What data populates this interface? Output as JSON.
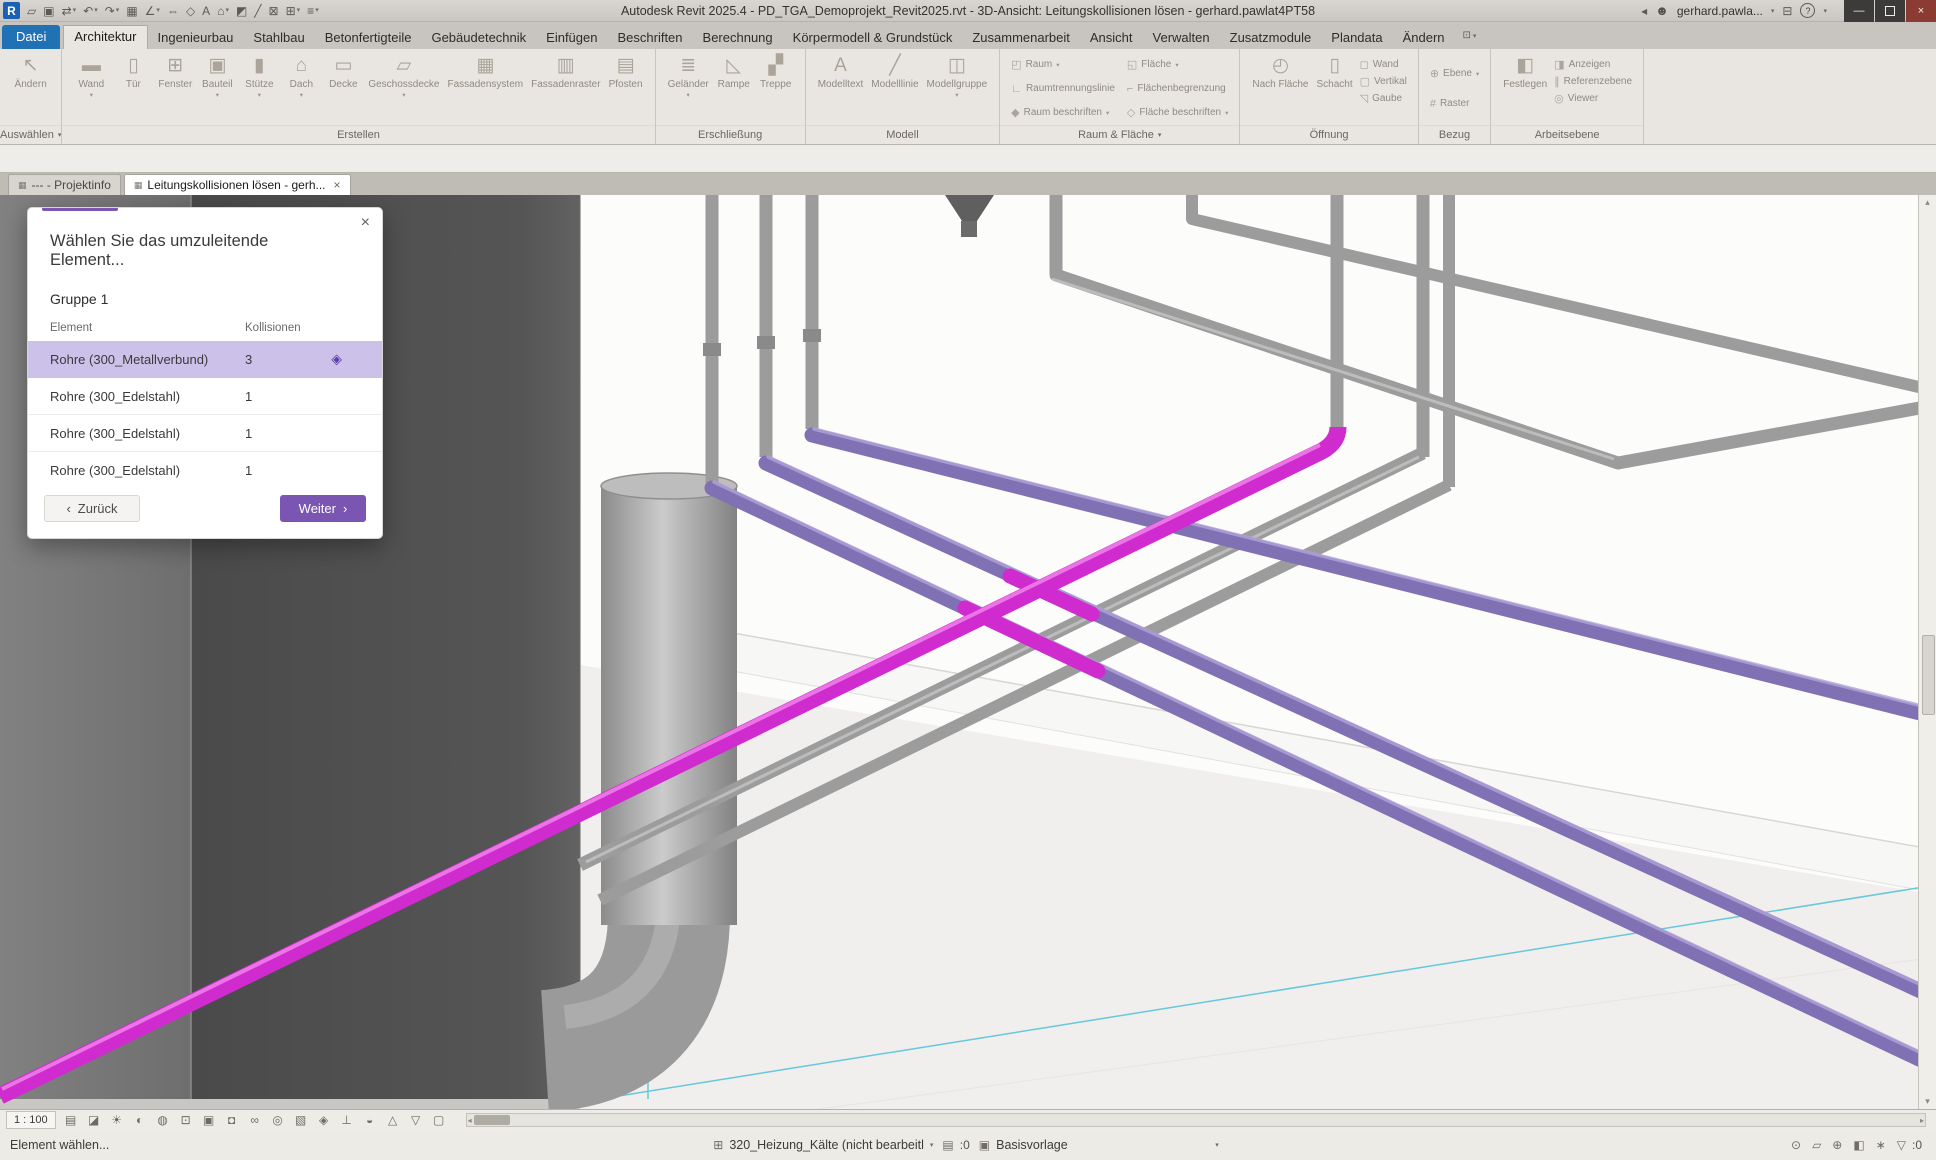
{
  "colors": {
    "accent_purple": "#7a55b2",
    "selection_magenta": "#cf2bcf",
    "pipe_purple": "#8070b4",
    "pipe_gray": "#9c9c9c",
    "datei_tab_blue": "#2171b5",
    "selected_row_bg": "#ccc1e9",
    "cyan_reference": "#66c7dd"
  },
  "title_bar": {
    "app_title": "Autodesk Revit 2025.4 - PD_TGA_Demoprojekt_Revit2025.rvt - 3D-Ansicht: Leitungskollisionen lösen - gerhard.pawlat4PT58",
    "user_name": "gerhard.pawla...",
    "qat_items": [
      {
        "name": "open-file"
      },
      {
        "name": "save"
      },
      {
        "name": "sync-with-central",
        "caret": true
      },
      {
        "name": "undo",
        "caret": true
      },
      {
        "name": "redo",
        "caret": true
      },
      {
        "name": "print"
      },
      {
        "name": "measure",
        "caret": true
      },
      {
        "name": "aligned-dimension"
      },
      {
        "name": "tag-by-category"
      },
      {
        "name": "text-note"
      },
      {
        "name": "default-3d-view",
        "caret": true
      },
      {
        "name": "section"
      },
      {
        "name": "thin-lines"
      },
      {
        "name": "close-hidden-windows"
      },
      {
        "name": "switch-windows",
        "caret": true
      },
      {
        "name": "customize-quick-access",
        "caret": true
      }
    ]
  },
  "ribbon": {
    "tabs": [
      {
        "label": "Datei",
        "datei": true
      },
      {
        "label": "Architektur",
        "active": true
      },
      {
        "label": "Ingenieurbau"
      },
      {
        "label": "Stahlbau"
      },
      {
        "label": "Betonfertigteile"
      },
      {
        "label": "Gebäudetechnik"
      },
      {
        "label": "Einfügen"
      },
      {
        "label": "Beschriften"
      },
      {
        "label": "Berechnung"
      },
      {
        "label": "Körpermodell & Grundstück"
      },
      {
        "label": "Zusammenarbeit"
      },
      {
        "label": "Ansicht"
      },
      {
        "label": "Verwalten"
      },
      {
        "label": "Zusatzmodule"
      },
      {
        "label": "Plandata"
      },
      {
        "label": "Ändern"
      }
    ],
    "panels": [
      {
        "label": "Auswählen",
        "dropdown": true,
        "layout": "row",
        "buttons": [
          {
            "label": "Ändern",
            "icon": "cursor",
            "size": "large"
          }
        ]
      },
      {
        "label": "Erstellen",
        "layout": "row",
        "buttons": [
          {
            "label": "Wand",
            "icon": "wall",
            "size": "large",
            "dropdown": true
          },
          {
            "label": "Tür",
            "icon": "door",
            "size": "large"
          },
          {
            "label": "Fenster",
            "icon": "window",
            "size": "large"
          },
          {
            "label": "Bauteil",
            "icon": "component",
            "size": "large",
            "dropdown": true
          },
          {
            "label": "Stütze",
            "icon": "column",
            "size": "large",
            "dropdown": true
          },
          {
            "label": "Dach",
            "icon": "roof",
            "size": "large",
            "dropdown": true
          },
          {
            "label": "Decke",
            "icon": "ceiling",
            "size": "large"
          },
          {
            "label": "Geschossdecke",
            "icon": "floor",
            "size": "large",
            "dropdown": true
          },
          {
            "label": "Fassadensystem",
            "icon": "curtain-system",
            "size": "large"
          },
          {
            "label": "Fassadenraster",
            "icon": "curtain-grid",
            "size": "large"
          },
          {
            "label": "Pfosten",
            "icon": "mullion",
            "size": "large"
          }
        ]
      },
      {
        "label": "Erschließung",
        "layout": "row",
        "buttons": [
          {
            "label": "Geländer",
            "icon": "railing",
            "size": "large",
            "dropdown": true
          },
          {
            "label": "Rampe",
            "icon": "ramp",
            "size": "large"
          },
          {
            "label": "Treppe",
            "icon": "stair",
            "size": "large"
          }
        ]
      },
      {
        "label": "Modell",
        "layout": "row",
        "buttons": [
          {
            "label": "Modelltext",
            "icon": "model-text",
            "size": "large"
          },
          {
            "label": "Modelllinie",
            "icon": "model-line",
            "size": "large"
          },
          {
            "label": "Modellgruppe",
            "icon": "model-group",
            "size": "large",
            "dropdown": true
          }
        ]
      },
      {
        "label": "Raum & Fläche",
        "dropdown": true,
        "layout": "grid",
        "buttons": [
          {
            "label": "Raum",
            "icon": "room",
            "size": "small",
            "dropdown": true
          },
          {
            "label": "Raumtrennungslinie",
            "icon": "room-separator",
            "size": "small"
          },
          {
            "label": "Raum beschriften",
            "icon": "tag-room",
            "size": "small",
            "dropdown": true
          },
          {
            "label": "Fläche",
            "icon": "area",
            "size": "small",
            "dropdown": true
          },
          {
            "label": "Flächenbegrenzung",
            "icon": "area-boundary",
            "size": "small"
          },
          {
            "label": "Fläche beschriften",
            "icon": "tag-area",
            "size": "small",
            "dropdown": true
          }
        ]
      },
      {
        "label": "Öffnung",
        "layout": "mixed",
        "buttons": [
          {
            "label": "Nach Fläche",
            "icon": "opening-by-face",
            "size": "large"
          },
          {
            "label": "Schacht",
            "icon": "shaft",
            "size": "large"
          },
          {
            "label": "Wand",
            "icon": "wall-opening",
            "size": "small"
          },
          {
            "label": "Vertikal",
            "icon": "vertical-opening",
            "size": "small"
          },
          {
            "label": "Gaube",
            "icon": "dormer",
            "size": "small"
          }
        ]
      },
      {
        "label": "Bezug",
        "layout": "stack",
        "buttons": [
          {
            "label": "Ebene",
            "icon": "level",
            "size": "small",
            "dropdown": true
          },
          {
            "label": "Raster",
            "icon": "grid",
            "size": "small"
          }
        ]
      },
      {
        "label": "Arbeitsebene",
        "layout": "mixed",
        "buttons": [
          {
            "label": "Festlegen",
            "icon": "set-workplane",
            "size": "large"
          },
          {
            "label": "Anzeigen",
            "icon": "show-workplane",
            "size": "small"
          },
          {
            "label": "Referenzebene",
            "icon": "ref-plane",
            "size": "small"
          },
          {
            "label": "Viewer",
            "icon": "viewer",
            "size": "small"
          }
        ]
      }
    ]
  },
  "view_tabs": [
    {
      "label": "--- - Projektinfo",
      "active": false,
      "closable": false
    },
    {
      "label": "Leitungskollisionen lösen - gerh...",
      "active": true,
      "closable": true
    }
  ],
  "dialog": {
    "title": "Wählen Sie das umzuleitende Element...",
    "group_label": "Gruppe 1",
    "columns": [
      "Element",
      "Kollisionen"
    ],
    "rows": [
      {
        "element": "Rohre (300_Metallverbund)",
        "collisions": "3",
        "selected": true
      },
      {
        "element": "Rohre (300_Edelstahl)",
        "collisions": "1",
        "selected": false
      },
      {
        "element": "Rohre (300_Edelstahl)",
        "collisions": "1",
        "selected": false
      },
      {
        "element": "Rohre (300_Edelstahl)",
        "collisions": "1",
        "selected": false
      }
    ],
    "back_label": "Zurück",
    "next_label": "Weiter"
  },
  "view_control_bar": {
    "scale": "1 : 100",
    "icons": [
      "detail-level",
      "visual-style",
      "sun-path",
      "shadows",
      "rendering",
      "crop-view",
      "crop-region",
      "lock-view",
      "hide-isolate",
      "reveal-hidden",
      "view-properties",
      "displacement",
      "constraints",
      "worksharing",
      "analytical",
      "filter-temp",
      "section-box"
    ]
  },
  "status_bar": {
    "hint": "Element wählen...",
    "workset": {
      "icon": "workset",
      "label": "320_Heizung_Kälte (nicht bearbeitl",
      "caret": true
    },
    "requests": {
      "icon": "requests",
      "count": ":0"
    },
    "design_option": {
      "icon": "design-options",
      "label": "Basisvorlage",
      "caret": true
    },
    "right_icons": [
      "select-links",
      "select-underlay",
      "select-pinned",
      "select-by-face",
      "drag-elements"
    ],
    "filter": {
      "icon": "filter",
      "count": ":0"
    }
  }
}
